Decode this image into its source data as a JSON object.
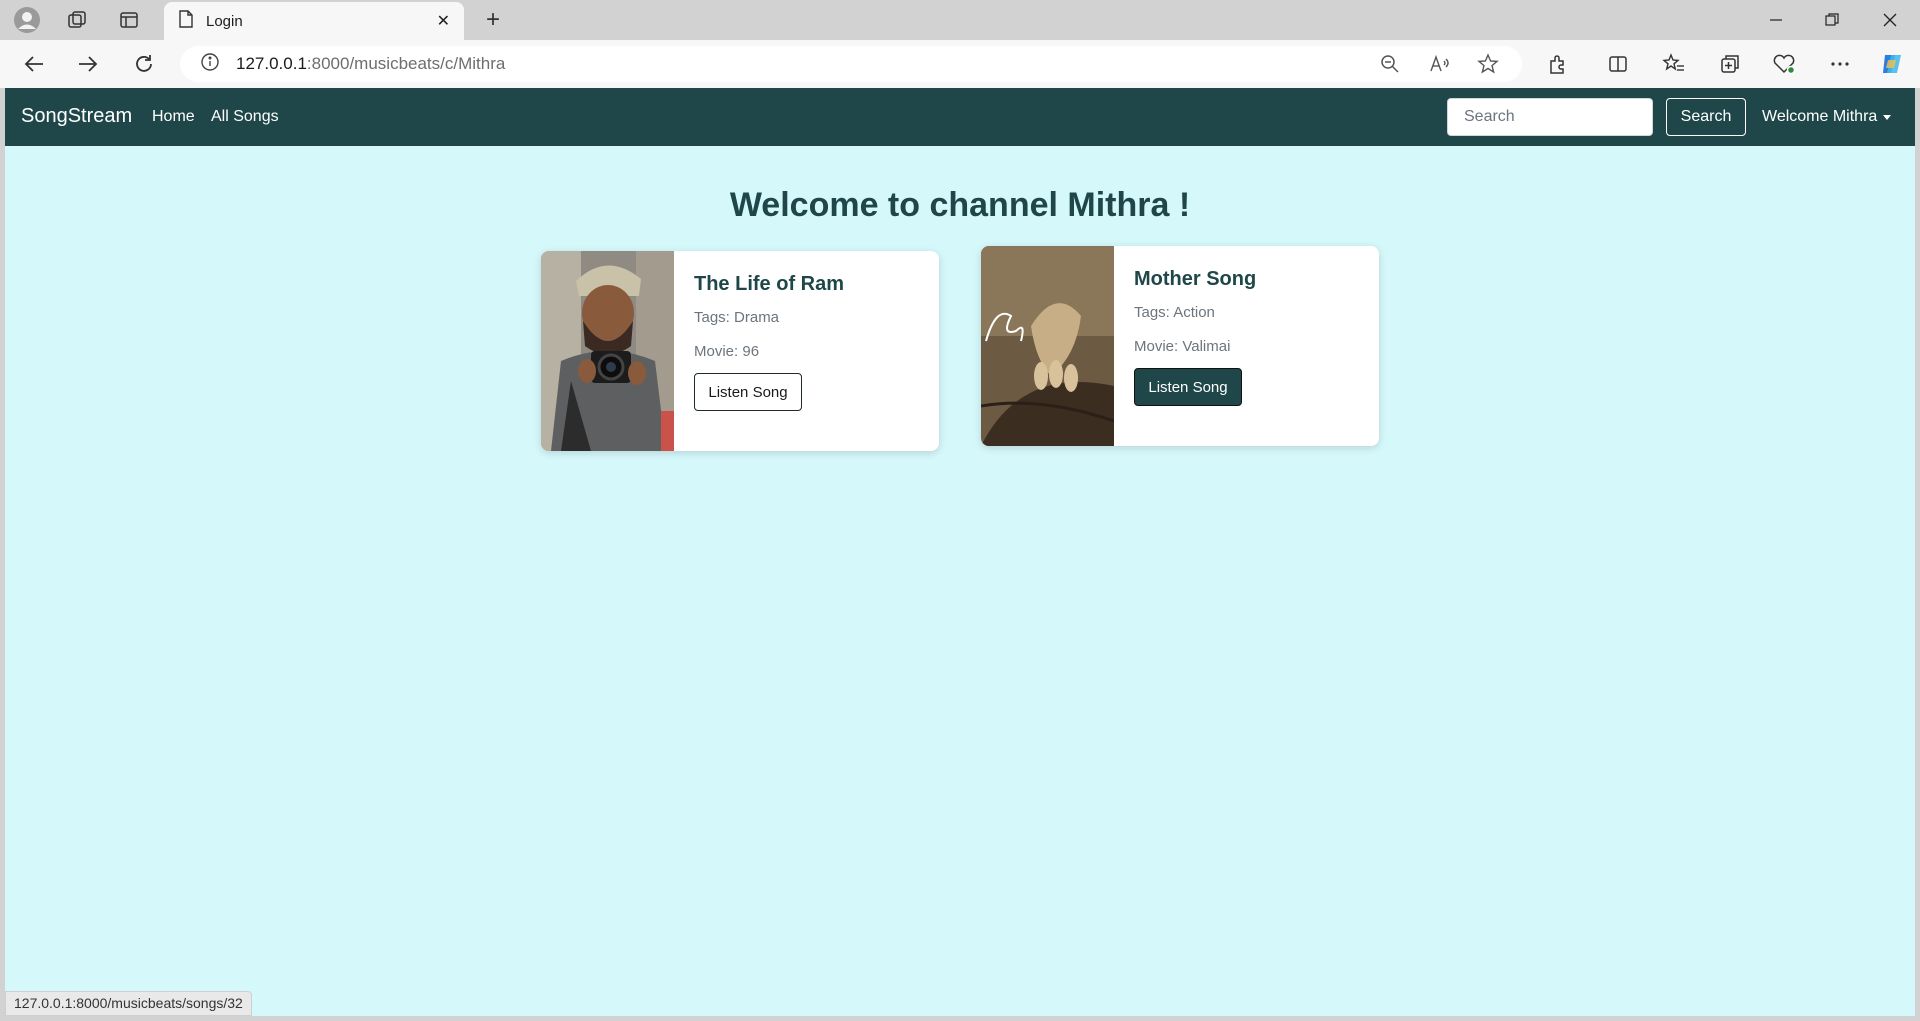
{
  "browser": {
    "tab_title": "Login",
    "url_host": "127.0.0.1",
    "url_rest": ":8000/musicbeats/c/Mithra",
    "status_url": "127.0.0.1:8000/musicbeats/songs/32"
  },
  "navbar": {
    "brand": "SongStream",
    "links": [
      "Home",
      "All Songs"
    ],
    "search_placeholder": "Search",
    "search_button": "Search",
    "user_menu": "Welcome Mithra"
  },
  "page": {
    "heading": "Welcome to channel Mithra !"
  },
  "songs": [
    {
      "title": "The Life of Ram",
      "tags": "Tags: Drama",
      "movie": "Movie: 96",
      "button": "Listen Song"
    },
    {
      "title": "Mother Song",
      "tags": "Tags: Action",
      "movie": "Movie: Valimai",
      "button": "Listen Song"
    }
  ],
  "colors": {
    "navbar": "#1f4749",
    "page_bg": "#d5f8fb",
    "accent": "#1f4749"
  }
}
